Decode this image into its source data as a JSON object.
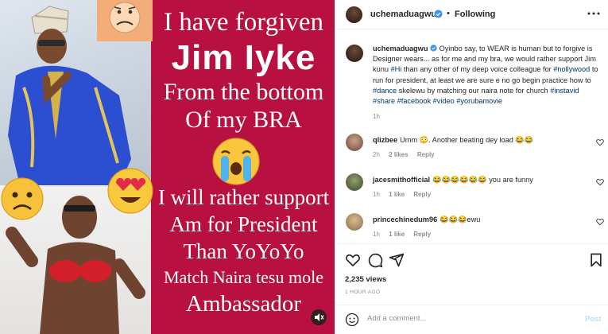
{
  "media": {
    "slogan": {
      "line1": "I have forgiven",
      "line2": "Jim Iyke",
      "line3": "From the bottom",
      "line4": "Of my BRA",
      "line5": "I will rather support",
      "line6": "Am for President",
      "line7": "Than YoYoYo",
      "line8": "Match Naira tesu mole",
      "line9": "Ambassador"
    },
    "colors": {
      "background": "#b81141",
      "text": "#ffffff"
    },
    "icons": [
      "frown-emoji",
      "crying-emoji",
      "heart-eyes-emoji",
      "sad-emoji",
      "mute-icon"
    ]
  },
  "header": {
    "username": "uchemaduagwu",
    "separator": "•",
    "follow_status": "Following",
    "more_icon": "more-icon"
  },
  "caption": {
    "username": "uchemaduagwu",
    "text_before_tag1": "Oyinbo say, to WEAR is human but to forgive is Designer wears... as for me and my bra, we would rather support Jim kunu ",
    "tag_hi": "#Hi",
    "text_mid1": " than any other of my deep voice colleague for ",
    "tag_nollywood": "#nollywood",
    "text_mid2": " to run for president, at least we are sure e no go begin practice how to ",
    "tag_dance": "#dance",
    "text_mid3": " skelewu by matching our naira note for church ",
    "tag_instavid": "#instavid",
    "tag_share": "#share",
    "tag_facebook": "#facebook",
    "tag_video": "#video",
    "tag_yorubamovie": "#yorubamovie",
    "time": "1h"
  },
  "comments": [
    {
      "username": "qlizbee",
      "text": "Umm 😳. Another beating dey load 😂😂",
      "time": "2h",
      "likes": "2 likes",
      "reply": "Reply"
    },
    {
      "username": "jacesmithofficial",
      "text": "😂😂😂😂😂😂 you are funny",
      "time": "1h",
      "likes": "1 like",
      "reply": "Reply"
    },
    {
      "username": "princechinedum96",
      "text": "😂😂😂ewu",
      "time": "1h",
      "likes": "1 like",
      "reply": "Reply"
    }
  ],
  "actions": {
    "icons": [
      "heart-icon",
      "comment-icon",
      "share-icon",
      "bookmark-icon"
    ],
    "views": "2,235 views",
    "posted": "1 HOUR AGO"
  },
  "composer": {
    "placeholder": "Add a comment...",
    "post_label": "Post",
    "icon": "emoji-icon"
  }
}
